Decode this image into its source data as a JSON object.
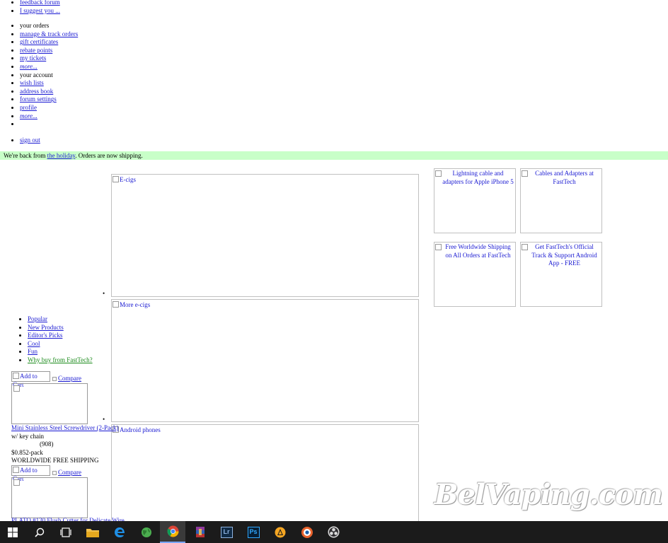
{
  "top_links": [
    "feedback forum",
    "I suggest you ..."
  ],
  "account_menu": [
    {
      "label": "your orders",
      "link": false
    },
    {
      "label": "manage & track orders",
      "link": true
    },
    {
      "label": "gift certificates",
      "link": true
    },
    {
      "label": "rebate points",
      "link": true
    },
    {
      "label": "my tickets",
      "link": true
    },
    {
      "label": "more...",
      "link": true,
      "italic": true
    },
    {
      "label": "your account",
      "link": false
    },
    {
      "label": "wish lists",
      "link": true
    },
    {
      "label": "address book",
      "link": true
    },
    {
      "label": "forum settings",
      "link": true
    },
    {
      "label": "profile",
      "link": true
    },
    {
      "label": "more...",
      "link": true,
      "italic": true
    },
    {
      "label": "",
      "link": false
    }
  ],
  "signout": "sign out",
  "notice": {
    "before": "We're back from ",
    "link": "the holiday",
    "after": ". Orders are now shipping."
  },
  "banners": [
    "E-cigs",
    "More e-cigs",
    "Android phones"
  ],
  "ads": [
    "Lightning cable and adapters for Apple iPhone 5",
    "Cables and Adapters at FastTech",
    "Free Worldwide Shipping on All Orders at FastTech",
    "Get FastTech's Official Track & Support Android App - FREE"
  ],
  "categories": [
    "Popular",
    "New Products",
    "Editor's Picks",
    "Cool",
    "Fun",
    "Why buy from FastTech?"
  ],
  "product": {
    "cart_label": "Add to Cart",
    "compare_label": "Compare",
    "name": "Mini Stainless Steel Screwdriver (2-Pack)",
    "name_continued": "w/ key chain",
    "reviews": "(908)",
    "price": "$0.852-pack",
    "shipping": "WORLDWIDE FREE SHIPPING"
  },
  "product2": {
    "cart_label": "Add to Cart",
    "compare_label": "Compare",
    "name_partial": "PLATO #130 Flush Cutter for Delicate Wire"
  },
  "watermark": "BelVaping.com",
  "taskbar": {
    "apps": [
      "windows-start",
      "search",
      "task-view",
      "file-explorer",
      "edge",
      "maps",
      "chrome",
      "winrar",
      "lightroom",
      "photoshop",
      "vlc-player",
      "app-orange",
      "obs"
    ],
    "lr_label": "Lr",
    "ps_label": "Ps"
  }
}
